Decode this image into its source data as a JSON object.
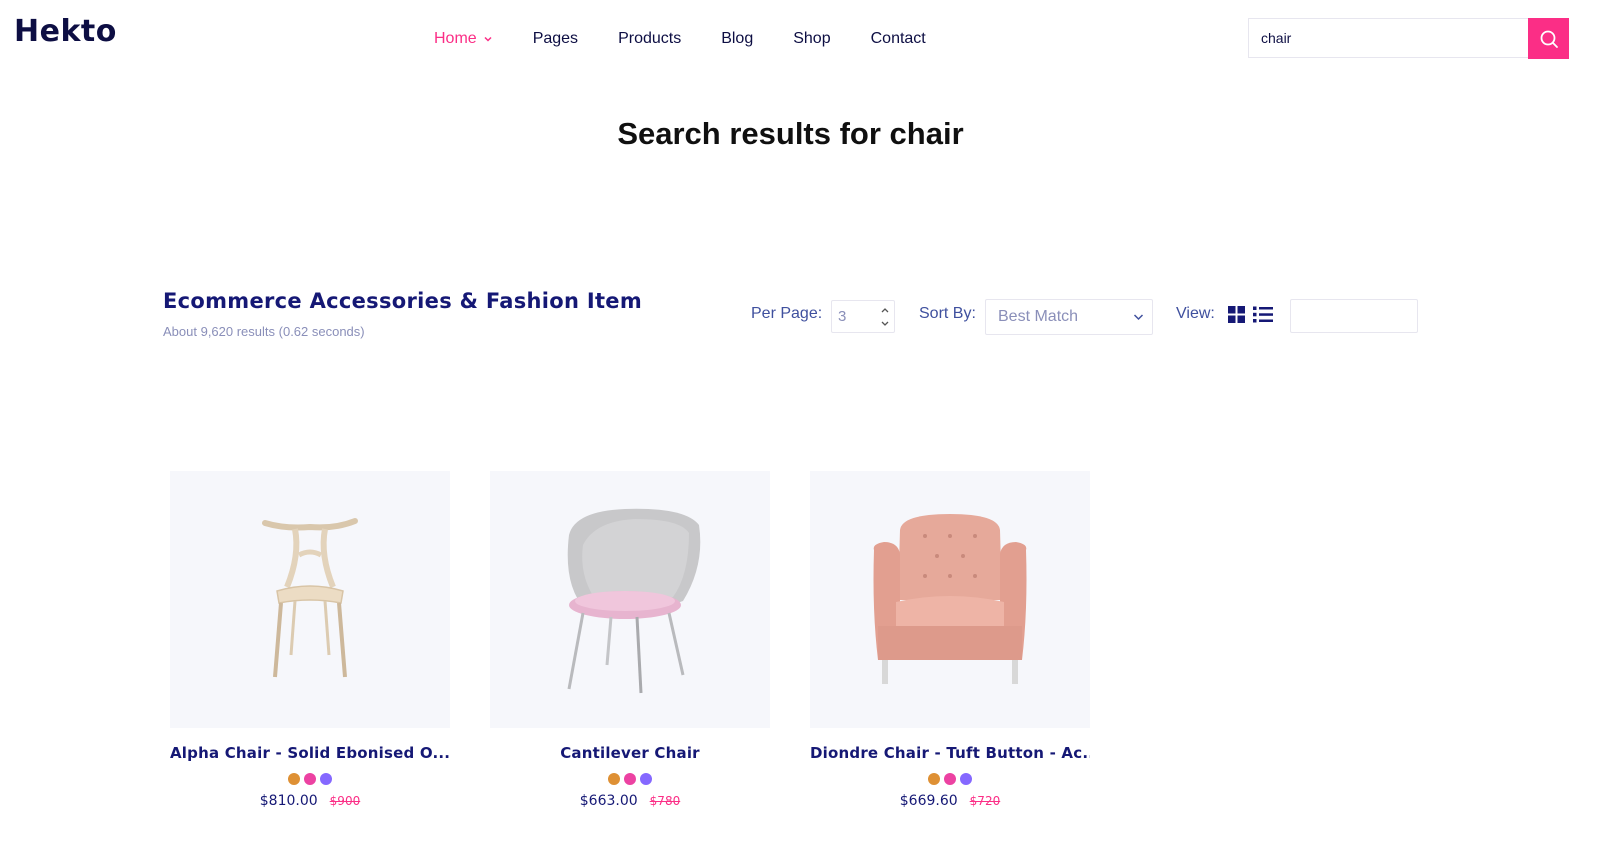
{
  "brand": {
    "logo": "Hekto"
  },
  "nav": {
    "items": [
      {
        "label": "Home",
        "active": true
      },
      {
        "label": "Pages",
        "active": false
      },
      {
        "label": "Products",
        "active": false
      },
      {
        "label": "Blog",
        "active": false
      },
      {
        "label": "Shop",
        "active": false
      },
      {
        "label": "Contact",
        "active": false
      }
    ]
  },
  "search": {
    "value": "chair",
    "button_icon": "search-icon"
  },
  "results_heading": "Search results for chair",
  "section": {
    "title": "Ecommerce Accessories & Fashion Item",
    "results_count": "About 9,620 results (0.62 seconds)"
  },
  "toolbar": {
    "per_page_label": "Per Page:",
    "per_page_value": "3",
    "sort_label": "Sort By:",
    "sort_value": "Best Match",
    "view_label": "View:",
    "view_icons": [
      "grid-view-icon",
      "list-view-icon"
    ]
  },
  "colors": {
    "accent": "#fb2e86",
    "navy": "#151875",
    "card_bg": "#f6f7fb",
    "swatches": [
      "#de9034",
      "#ec42a2",
      "#8568ff"
    ]
  },
  "products": [
    {
      "name": "Alpha Chair - Solid Ebonised O...",
      "price": "$810.00",
      "old_price": "$900",
      "image_icon": "wooden-chair-image"
    },
    {
      "name": "Cantilever Chair",
      "price": "$663.00",
      "old_price": "$780",
      "image_icon": "grey-shell-chair-image"
    },
    {
      "name": "Diondre Chair - Tuft Button - Ac...",
      "price": "$669.60",
      "old_price": "$720",
      "image_icon": "pink-armchair-image"
    }
  ]
}
